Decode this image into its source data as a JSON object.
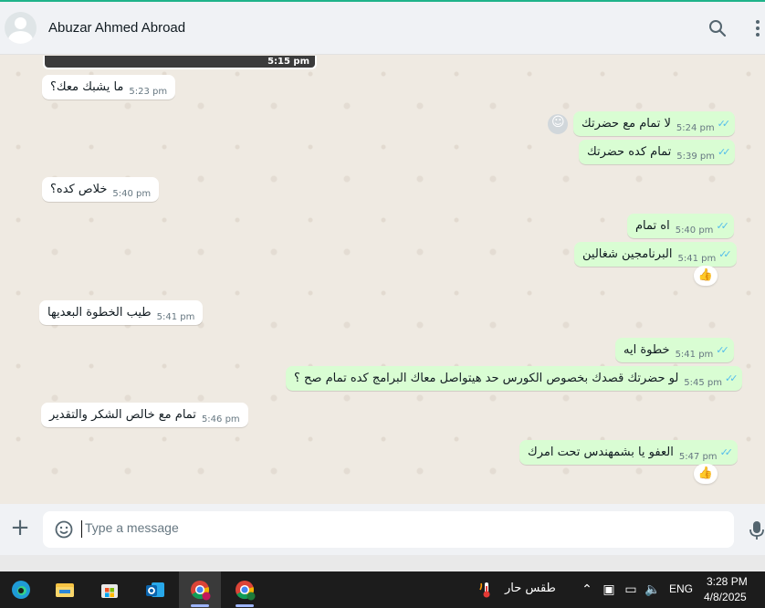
{
  "header": {
    "contact_name": "Abuzar Ahmed Abroad"
  },
  "media": {
    "time": "5:15 pm"
  },
  "messages": [
    {
      "dir": "in",
      "text": "ما يشبك معك؟",
      "time": "5:23 pm"
    },
    {
      "dir": "out",
      "text": "لا تمام مع حضرتك",
      "time": "5:24 pm"
    },
    {
      "dir": "out",
      "text": "تمام كده حضرتك",
      "time": "5:39 pm"
    },
    {
      "dir": "in",
      "text": "خلاص كده؟",
      "time": "5:40 pm"
    },
    {
      "dir": "out",
      "text": "اه تمام",
      "time": "5:40 pm"
    },
    {
      "dir": "out",
      "text": "البرنامجين شغالين",
      "time": "5:41 pm"
    },
    {
      "dir": "in",
      "text": "طيب الخطوة البعديها",
      "time": "5:41 pm"
    },
    {
      "dir": "out",
      "text": "خطوة ايه",
      "time": "5:41 pm"
    },
    {
      "dir": "out",
      "text": "لو حضرتك قصدك بخصوص الكورس حد هيتواصل معاك البرامج كده تمام صح ؟",
      "time": "5:45 pm"
    },
    {
      "dir": "in",
      "text": "تمام مع خالص الشكر والتقدير",
      "time": "5:46 pm"
    },
    {
      "dir": "out",
      "text": "العفو يا بشمهندس تحت امرك",
      "time": "5:47 pm"
    }
  ],
  "reactions": {
    "thumbs": "👍"
  },
  "composer": {
    "placeholder": "Type a message"
  },
  "taskbar": {
    "weather": "طقس حار",
    "language": "ENG",
    "time": "3:28 PM",
    "date": "4/8/2025"
  },
  "colors": {
    "incoming_bubble": "#ffffff",
    "outgoing_bubble": "#d9fdd3",
    "read_ticks": "#53bdeb",
    "accent": "#1fb38a"
  }
}
